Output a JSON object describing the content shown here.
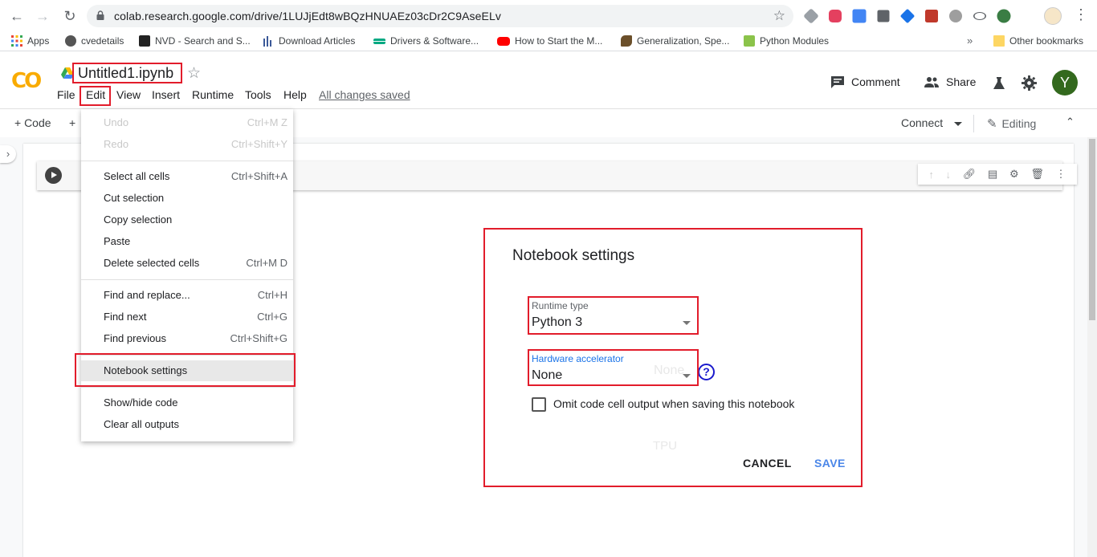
{
  "browser": {
    "url": "colab.research.google.com/drive/1LUJjEdt8wBQzHNUAEz03cDr2C9AseELv"
  },
  "bookmarks": [
    {
      "label": "Apps",
      "color": "#4285f4"
    },
    {
      "label": "cvedetails",
      "color": "#555555"
    },
    {
      "label": "NVD - Search and S...",
      "color": "#222222"
    },
    {
      "label": "Download Articles",
      "color": "#3b5998"
    },
    {
      "label": "Drivers & Software...",
      "color": "#01a982"
    },
    {
      "label": "How to Start the M...",
      "color": "#ff0000"
    },
    {
      "label": "Generalization, Spe...",
      "color": "#6b4f2a"
    },
    {
      "label": "Python Modules",
      "color": "#8bc34a"
    }
  ],
  "bookmarks_more": "»",
  "other_bookmarks": "Other bookmarks",
  "colab": {
    "logo": "CO",
    "title": "Untitled1.ipynb",
    "menu": [
      "File",
      "Edit",
      "View",
      "Insert",
      "Runtime",
      "Tools",
      "Help"
    ],
    "saved_status": "All changes saved",
    "comment": "Comment",
    "share": "Share",
    "user_initial": "Y"
  },
  "toolbar": {
    "add_code": "+ Code",
    "add_text": "+",
    "connect": "Connect",
    "editing": "Editing"
  },
  "edit_menu": {
    "undo": {
      "label": "Undo",
      "shortcut": "Ctrl+M Z"
    },
    "redo": {
      "label": "Redo",
      "shortcut": "Ctrl+Shift+Y"
    },
    "select_all": {
      "label": "Select all cells",
      "shortcut": "Ctrl+Shift+A"
    },
    "cut": {
      "label": "Cut selection",
      "shortcut": ""
    },
    "copy": {
      "label": "Copy selection",
      "shortcut": ""
    },
    "paste": {
      "label": "Paste",
      "shortcut": ""
    },
    "delete": {
      "label": "Delete selected cells",
      "shortcut": "Ctrl+M D"
    },
    "find_replace": {
      "label": "Find and replace...",
      "shortcut": "Ctrl+H"
    },
    "find_next": {
      "label": "Find next",
      "shortcut": "Ctrl+G"
    },
    "find_prev": {
      "label": "Find previous",
      "shortcut": "Ctrl+Shift+G"
    },
    "nb_settings": {
      "label": "Notebook settings",
      "shortcut": ""
    },
    "show_hide": {
      "label": "Show/hide code",
      "shortcut": ""
    },
    "clear_outputs": {
      "label": "Clear all outputs",
      "shortcut": ""
    }
  },
  "dialog": {
    "title": "Notebook settings",
    "runtime_label": "Runtime type",
    "runtime_value": "Python 3",
    "hw_label": "Hardware accelerator",
    "hw_value": "None",
    "hw_ghost_none": "None",
    "hw_ghost_tpu": "TPU",
    "omit_label": "Omit code cell output when saving this notebook",
    "omit_checked": false,
    "cancel": "CANCEL",
    "save": "SAVE",
    "accent": "#1a73e8"
  },
  "annotation_color": "#e21c2b"
}
